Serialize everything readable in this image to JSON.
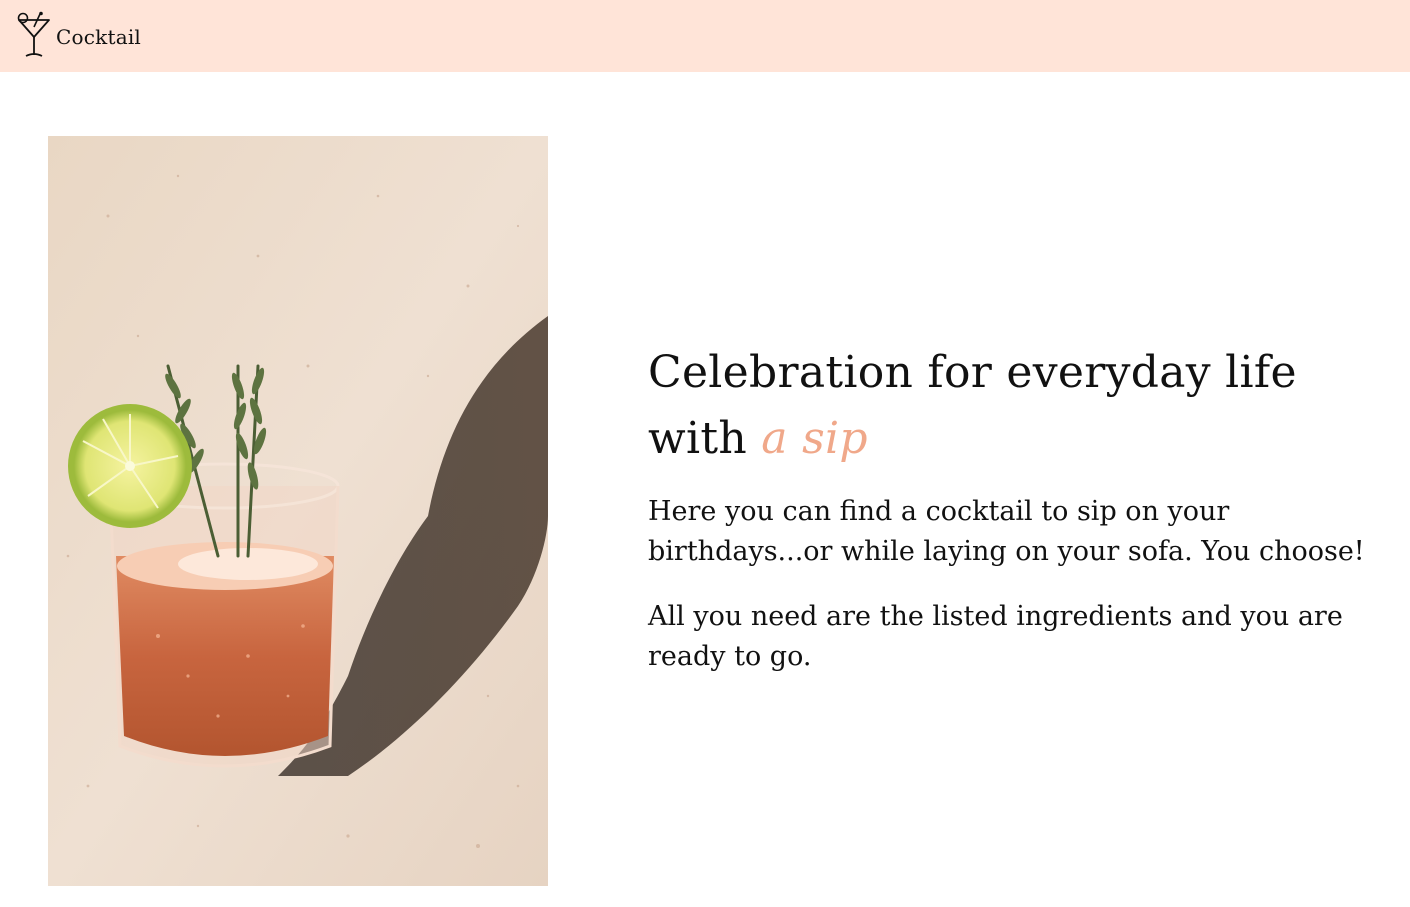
{
  "navbar": {
    "brand_label": "Cocktail",
    "logo_icon": "cocktail-glass-icon",
    "background": "#ffe4d8"
  },
  "hero": {
    "image_icon": "cocktail-photo",
    "headline_main": "Celebration for everyday life with",
    "headline_accent": "a sip",
    "accent_color": "#f0a88a",
    "paragraph_1": "Here you can find a cocktail to sip on your birthdays...or while laying on your sofa. You choose!",
    "paragraph_2": "All you need are the listed ingredients and you are ready to go."
  }
}
